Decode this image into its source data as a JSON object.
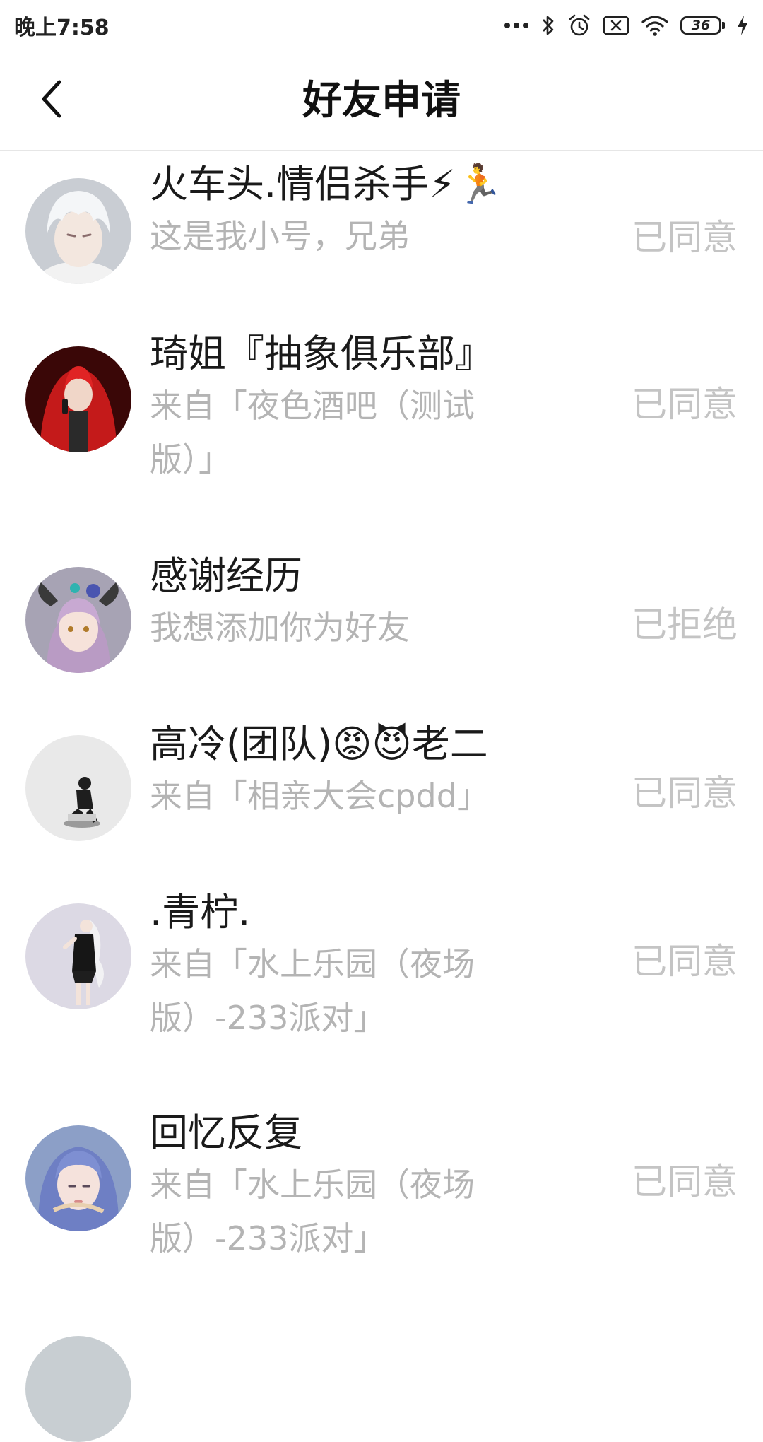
{
  "status_bar": {
    "time": "晚上7:58",
    "battery_level": "36",
    "battery_fraction": 0.36,
    "icons": [
      "more-dots-icon",
      "bluetooth-icon",
      "alarm-icon",
      "no-sim-icon",
      "wifi-icon",
      "battery-icon",
      "charging-bolt-icon"
    ]
  },
  "header": {
    "title": "好友申请",
    "back_icon": "back-chevron-icon"
  },
  "requests": [
    {
      "name": "火车头.情侣杀手⚡🏃",
      "message": "这是我小号，兄弟",
      "status": "已同意",
      "avatar": "avatar-white-hair-boy",
      "avatar_color": "#c9cdd3"
    },
    {
      "name": "琦姐『抽象俱乐部』",
      "message": "来自「夜色酒吧（测试版）」",
      "status": "已同意",
      "avatar": "avatar-red-hair-singer",
      "avatar_color": "#b71c1c"
    },
    {
      "name": "感谢经历",
      "message": "我想添加你为好友",
      "status": "已拒绝",
      "avatar": "avatar-horned-anime-girl",
      "avatar_color": "#a7a3b4"
    },
    {
      "name": "高冷(团队)😡😈老二",
      "message": "来自「相亲大会cpdd」",
      "status": "已同意",
      "avatar": "avatar-sitting-figure",
      "avatar_color": "#e9e9e9"
    },
    {
      "name": ".青柠.",
      "message": "来自「水上乐园（夜场版）-233派对」",
      "status": "已同意",
      "avatar": "avatar-girl-black-dress",
      "avatar_color": "#dcd9e4"
    },
    {
      "name": "回忆反复",
      "message": "来自「水上乐园（夜场版）-233派对」",
      "status": "已同意",
      "avatar": "avatar-blue-hair-girl",
      "avatar_color": "#8c9fc7"
    }
  ]
}
